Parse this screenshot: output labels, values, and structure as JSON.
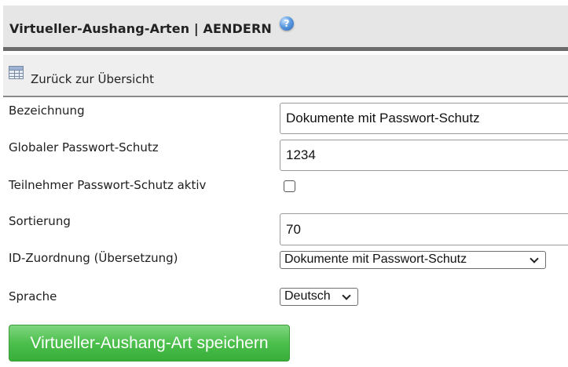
{
  "header": {
    "title": "Virtueller-Aushang-Arten | AENDERN",
    "help_icon": "help-question-icon",
    "help_glyph": "?"
  },
  "nav": {
    "back_label": "Zurück zur Übersicht",
    "back_icon": "table-grid-icon"
  },
  "form": {
    "bezeichnung": {
      "label": "Bezeichnung",
      "value": "Dokumente mit Passwort-Schutz"
    },
    "global_password": {
      "label": "Globaler Passwort-Schutz",
      "value": "1234"
    },
    "participant_password": {
      "label": "Teilnehmer Passwort-Schutz aktiv",
      "checked": false
    },
    "sortierung": {
      "label": "Sortierung",
      "value": "70"
    },
    "id_mapping": {
      "label": "ID-Zuordnung (Übersetzung)",
      "selected": "Dokumente mit Passwort-Schutz"
    },
    "sprache": {
      "label": "Sprache",
      "selected": "Deutsch"
    }
  },
  "actions": {
    "save_label": "Virtueller-Aushang-Art speichern"
  },
  "colors": {
    "save_button": "#4cbf4c",
    "title_bar": "#e6e6e6",
    "title_border": "#6b6b6b"
  }
}
